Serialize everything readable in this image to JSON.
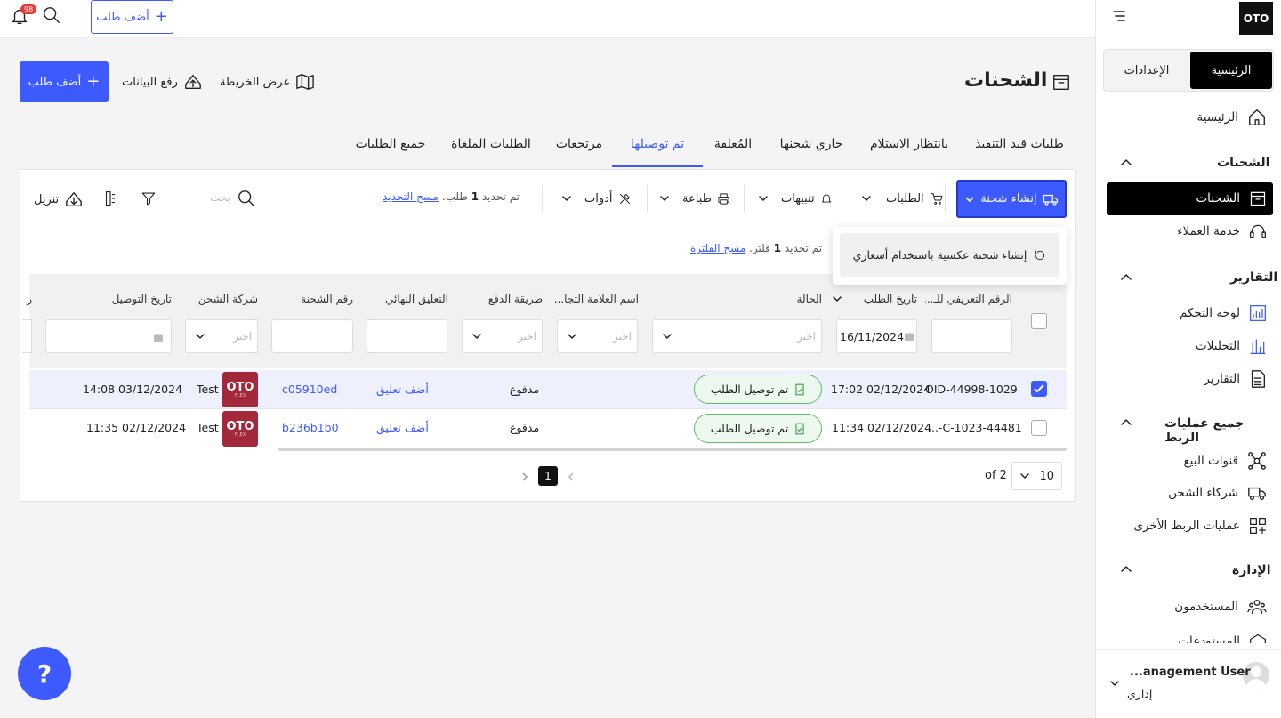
{
  "topbar": {
    "add_order": "أضف طلب",
    "notif_count": "98"
  },
  "sidebar": {
    "logo": "OTO",
    "seg_home": "الرئيسية",
    "seg_settings": "الإعدادات",
    "home": "الرئيسية",
    "sec_shipments": "الشحنات",
    "shipments": "الشحنات",
    "customer_service": "خدمة العملاء",
    "sec_reports": "التقارير",
    "dashboard": "لوحة التحكم",
    "analytics": "التحليلات",
    "reports": "التقارير",
    "sec_integrations": "جميع عمليات الربط",
    "sales_channels": "قنوات البيع",
    "shipping_partners": "شركاء الشحن",
    "other_integrations": "عمليات الربط الأخرى",
    "sec_admin": "الإدارة",
    "users": "المستخدمون",
    "cut_item": "المستودعات",
    "user_name": "...anagement User",
    "user_role": "إداري"
  },
  "page": {
    "title": "الشحنات",
    "map_view": "عرض الخريطة",
    "upload_data": "رفع البيانات",
    "add_order": "أضف طلب"
  },
  "tabs": [
    "طلبات قيد التنفيذ",
    "بانتظار الاستلام",
    "جاري شحنها",
    "المُعلقة",
    "تم توصيلها",
    "مرتجعات",
    "الطلبات الملغاة",
    "جميع الطلبات"
  ],
  "toolbar": {
    "create_shipment": "إنشاء شحنة",
    "orders": "الطلبات",
    "alerts": "تنبيهات",
    "print": "طباعة",
    "tools": "أدوات",
    "selected_prefix": "تم تحديد",
    "selected_count": "1",
    "selected_suffix": "طلب.",
    "clear_selection": "مسح التحديد",
    "search_placeholder": "بحث",
    "download": "تنزيل"
  },
  "dropdown": {
    "reverse": "إنشاء شحنة عكسية باستخدام أسعاري"
  },
  "filter": {
    "prefix": "تم تحديد",
    "count": "1",
    "suffix": "فلتر.",
    "clear": "مسح الفلترة"
  },
  "columns": [
    "الرقم التعريفي للـ...",
    "تاريخ الطلب",
    "الحالة",
    "اسم العلامة التجا...",
    "طريقة الدفع",
    "التعليق النهائي",
    "رقم الشحنة",
    "شركة الشحن",
    "تاريخ التوصيل"
  ],
  "filters": {
    "date": "16/11/2024",
    "choose": "اختر"
  },
  "rows": [
    {
      "id": "OID-44998-1029",
      "date": "17:02 02/12/2024",
      "status": "تم توصيل الطلب",
      "payment": "مدفوع",
      "comment": "أضف تعليق",
      "shipment": "c05910ed",
      "carrier_logo": "OTO",
      "carrier_sub": "FLEX",
      "carrier": "Test",
      "delivered": "14:08 03/12/2024"
    },
    {
      "id": "C-1023-44481-...",
      "date": "11:34 02/12/2024",
      "status": "تم توصيل الطلب",
      "payment": "مدفوع",
      "comment": "أضف تعليق",
      "shipment": "b236b1b0",
      "carrier_logo": "OTO",
      "carrier_sub": "FLEX",
      "carrier": "Test",
      "delivered": "11:35 02/12/2024"
    }
  ],
  "pagination": {
    "page_size": "10",
    "of_pages": "of 2",
    "current": "1"
  },
  "help": "?"
}
